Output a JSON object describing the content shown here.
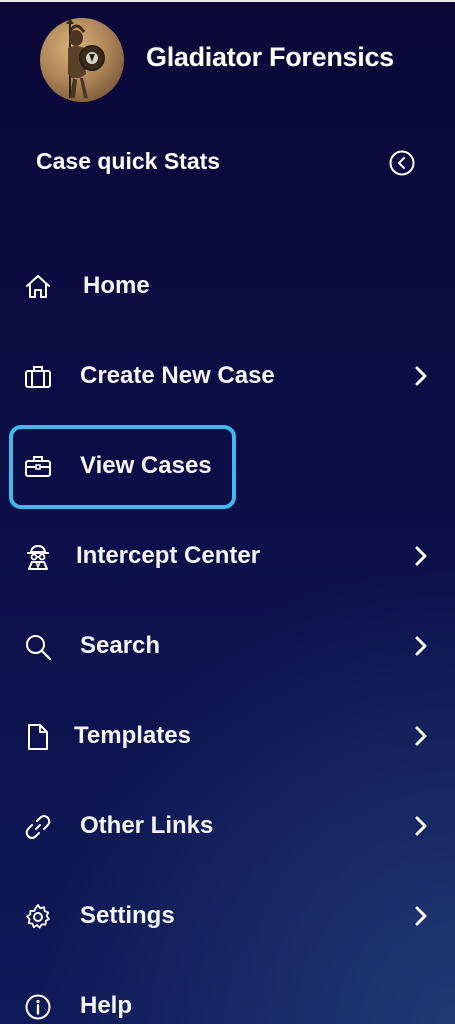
{
  "brand": {
    "name": "Gladiator Forensics",
    "logo_icon": "gladiator-logo"
  },
  "quick_stats": {
    "label": "Case quick Stats",
    "collapse_icon": "chevron-left-circle-icon"
  },
  "nav": {
    "items": [
      {
        "label": "Home",
        "icon": "home-icon",
        "has_submenu": false
      },
      {
        "label": "Create New Case",
        "icon": "briefcase-icon",
        "has_submenu": true
      },
      {
        "label": "View Cases",
        "icon": "suitcase-icon",
        "has_submenu": false,
        "highlighted": true
      },
      {
        "label": "Intercept Center",
        "icon": "spy-icon",
        "has_submenu": true
      },
      {
        "label": "Search",
        "icon": "search-icon",
        "has_submenu": true
      },
      {
        "label": "Templates",
        "icon": "file-icon",
        "has_submenu": true
      },
      {
        "label": "Other Links",
        "icon": "link-icon",
        "has_submenu": true
      },
      {
        "label": "Settings",
        "icon": "gear-icon",
        "has_submenu": true
      },
      {
        "label": "Help",
        "icon": "info-circle-icon",
        "has_submenu": false
      }
    ]
  },
  "colors": {
    "highlight": "#3eb9ec",
    "text": "#ffffff",
    "background": "#0c0d47"
  }
}
